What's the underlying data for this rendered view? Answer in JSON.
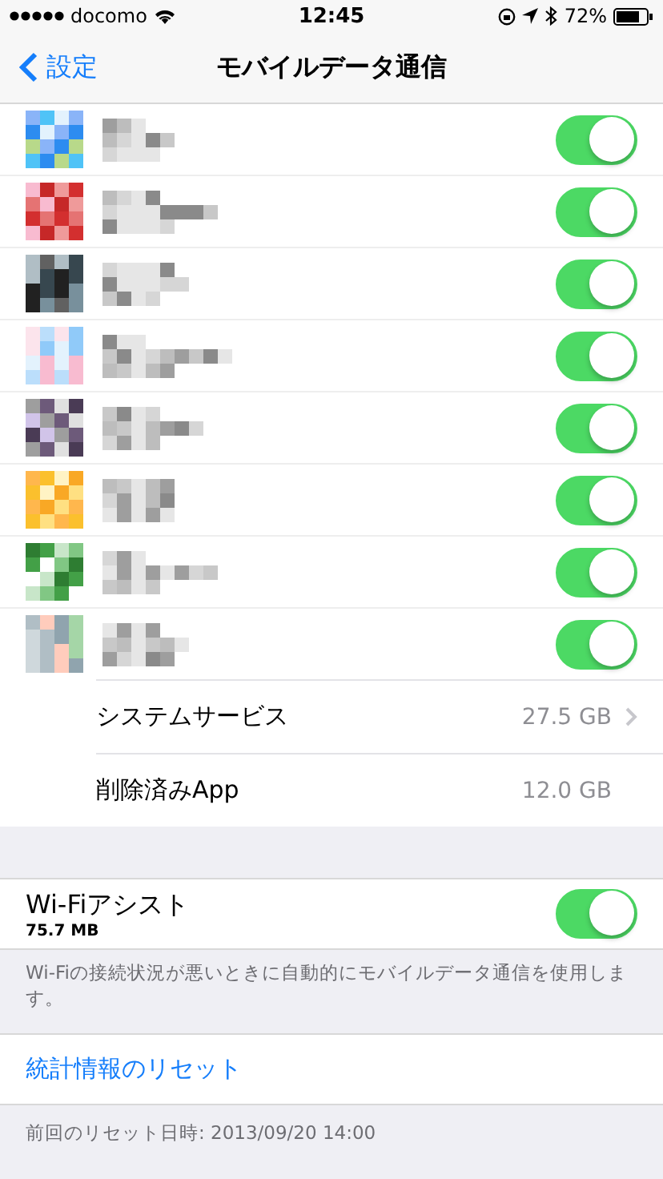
{
  "status_bar": {
    "carrier": "docomo",
    "time": "12:45",
    "battery": "72%"
  },
  "nav": {
    "back": "設定",
    "title": "モバイルデータ通信"
  },
  "apps": [
    {
      "kind": "picture",
      "on": true
    },
    {
      "kind": "picture",
      "on": true
    },
    {
      "kind": "picture",
      "on": true
    },
    {
      "kind": "picture",
      "on": true
    },
    {
      "kind": "picture",
      "on": true
    },
    {
      "kind": "picture",
      "on": true
    },
    {
      "kind": "picture",
      "on": true
    },
    {
      "kind": "picture",
      "on": true
    }
  ],
  "usage_rows": [
    {
      "label": "システムサービス",
      "value": "27.5 GB",
      "chevron": true
    },
    {
      "label": "削除済みApp",
      "value": "12.0 GB",
      "chevron": false
    }
  ],
  "wifi_assist": {
    "label": "Wi-Fiアシスト",
    "usage": "75.7 MB",
    "on": true,
    "note": "Wi-Fiの接続状況が悪いときに自動的にモバイルデータ通信を使用します。"
  },
  "reset": {
    "label": "統計情報のリセット",
    "note": "前回のリセット日時: 2013/09/20 14:00"
  }
}
